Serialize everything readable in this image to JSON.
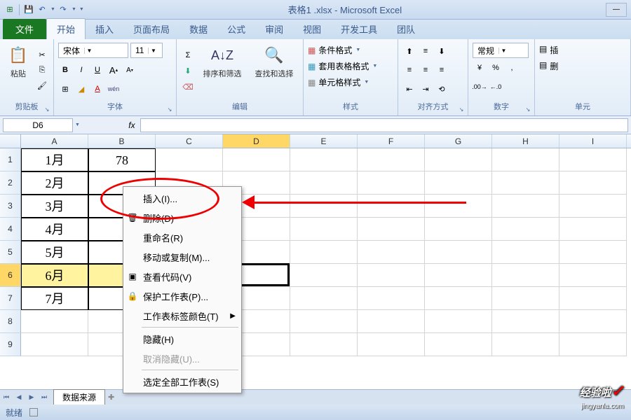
{
  "titlebar": {
    "title": "表格1 .xlsx - Microsoft Excel"
  },
  "tabs": {
    "file": "文件",
    "home": "开始",
    "insert": "插入",
    "layout": "页面布局",
    "data": "数据",
    "formulas": "公式",
    "review": "审阅",
    "view": "视图",
    "developer": "开发工具",
    "team": "团队"
  },
  "ribbon": {
    "clipboard": {
      "label": "剪贴板",
      "paste": "粘贴"
    },
    "font": {
      "label": "字体",
      "name": "宋体",
      "size": "11"
    },
    "edit": {
      "label": "编辑",
      "sort": "排序和筛选",
      "find": "查找和选择"
    },
    "styles": {
      "label": "样式",
      "cond": "条件格式",
      "table": "套用表格格式",
      "cell": "单元格样式"
    },
    "align": {
      "label": "对齐方式"
    },
    "number": {
      "label": "数字",
      "fmt": "常规"
    },
    "cells": {
      "label": "单元",
      "insert": "插",
      "delete": "删"
    }
  },
  "formula_bar": {
    "name_box": "D6",
    "fx": "fx"
  },
  "columns": [
    "A",
    "B",
    "C",
    "D",
    "E",
    "F",
    "G",
    "H",
    "I"
  ],
  "rows": [
    {
      "num": "1",
      "a": "1月",
      "b": "78"
    },
    {
      "num": "2",
      "a": "2月",
      "b": ""
    },
    {
      "num": "3",
      "a": "3月",
      "b": ""
    },
    {
      "num": "4",
      "a": "4月",
      "b": ""
    },
    {
      "num": "5",
      "a": "5月",
      "b": ""
    },
    {
      "num": "6",
      "a": "6月",
      "b": ""
    },
    {
      "num": "7",
      "a": "7月",
      "b": ""
    },
    {
      "num": "8",
      "a": "",
      "b": ""
    },
    {
      "num": "9",
      "a": "",
      "b": ""
    }
  ],
  "context_menu": {
    "insert": "插入(I)...",
    "delete": "删除(D)",
    "rename": "重命名(R)",
    "move": "移动或复制(M)...",
    "view_code": "查看代码(V)",
    "protect": "保护工作表(P)...",
    "tab_color": "工作表标签颜色(T)",
    "hide": "隐藏(H)",
    "unhide": "取消隐藏(U)...",
    "select_all": "选定全部工作表(S)"
  },
  "sheet": {
    "name": "数据来源"
  },
  "status": {
    "ready": "就绪"
  },
  "watermark": {
    "main": "经验啦",
    "sub": "jingyanla.com"
  }
}
